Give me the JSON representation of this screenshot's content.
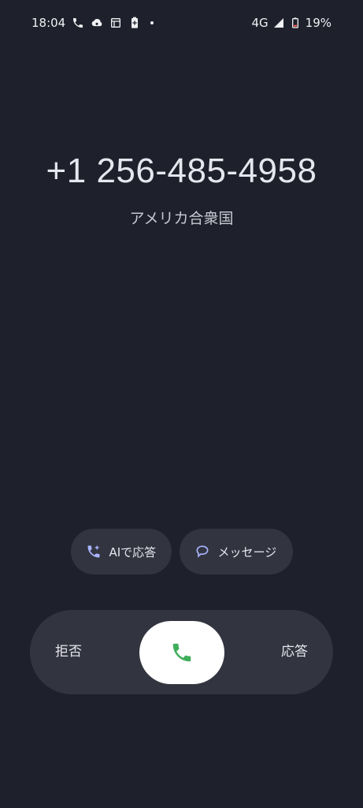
{
  "status_bar": {
    "time": "18:04",
    "network": "4G",
    "battery": "19%",
    "left_icons": [
      "phone-icon",
      "cloud-sync-icon",
      "sim-card-icon",
      "battery-saver-icon"
    ],
    "right_icons": [
      "signal-icon",
      "battery-icon"
    ]
  },
  "caller": {
    "number": "+1 256-485-4958",
    "location": "アメリカ合衆国"
  },
  "actions": {
    "ai_answer_label": "AIで応答",
    "message_label": "メッセージ"
  },
  "answer_slider": {
    "decline_label": "拒否",
    "answer_label": "応答"
  },
  "colors": {
    "background": "#1e202b",
    "chip_background": "#32343f",
    "accent_icon": "#a9b4ff",
    "answer_green": "#3fae5a",
    "handle": "#ffffff"
  }
}
